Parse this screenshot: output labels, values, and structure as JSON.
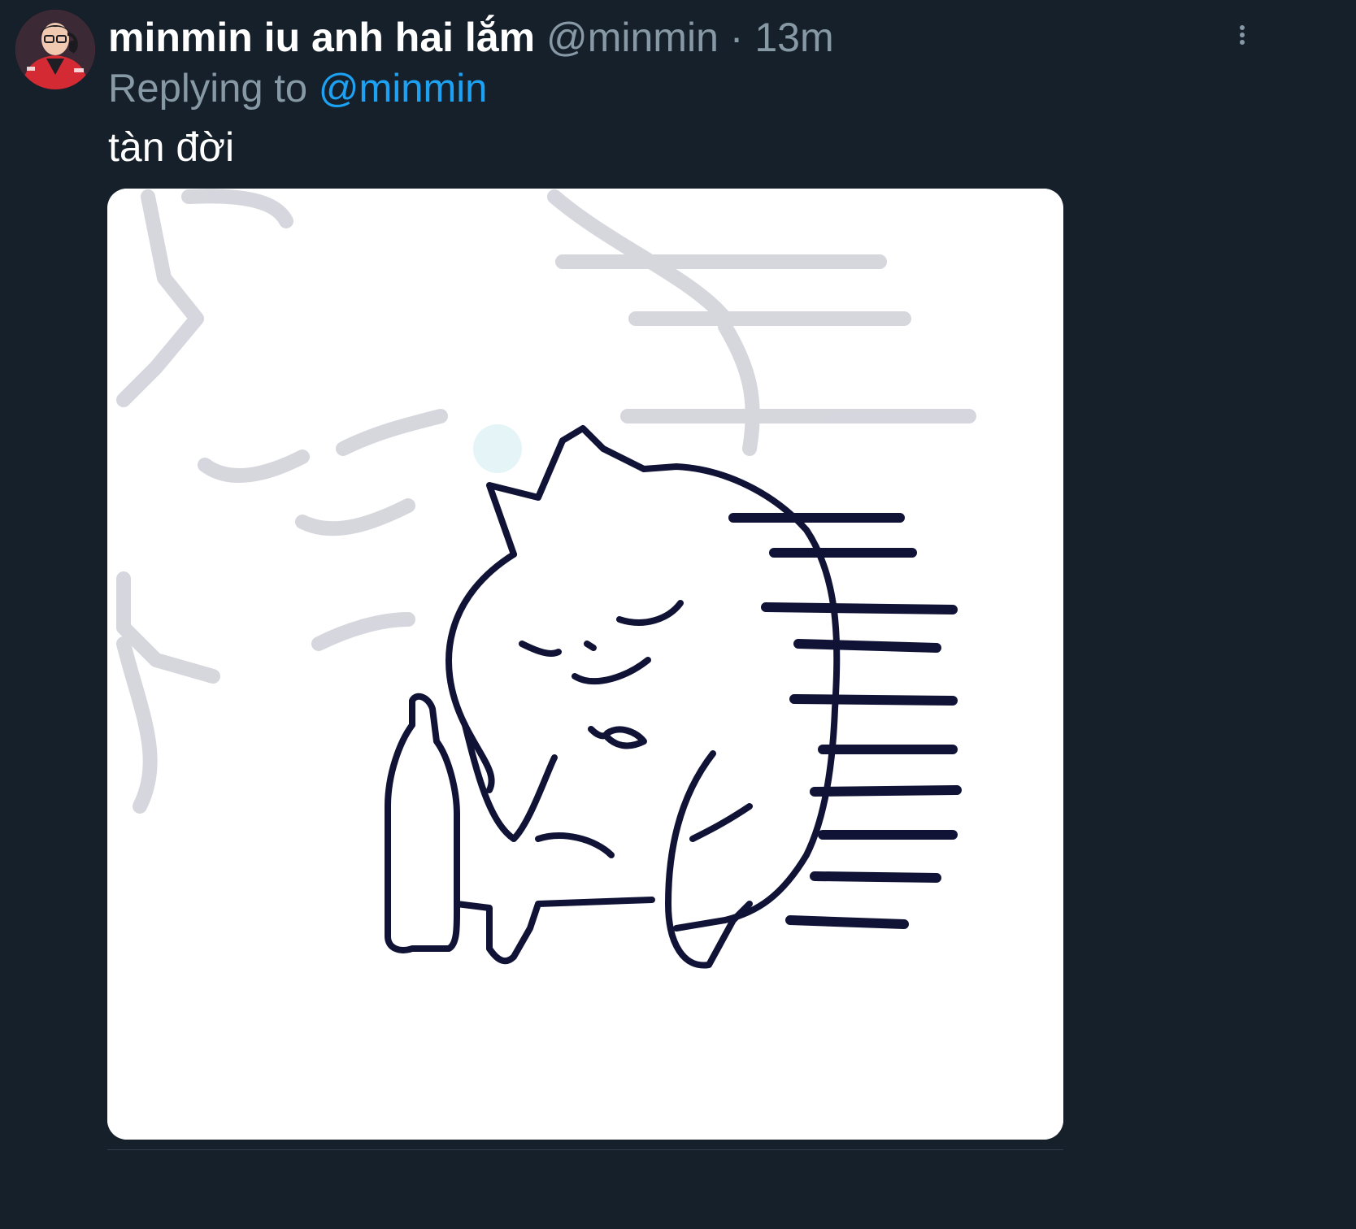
{
  "tweet": {
    "display_name": "minmin iu anh hai lắm",
    "handle": "@minmin",
    "separator": "·",
    "timestamp": "13m",
    "reply_prefix": "Replying to",
    "reply_handle": "@minmin",
    "text": "tàn đời"
  },
  "icons": {
    "more": "more-vertical-icon",
    "avatar": "profile-avatar"
  },
  "colors": {
    "background": "#15202b",
    "name": "#ffffff",
    "secondary_text": "#8899a6",
    "link": "#1da1f2",
    "avatar_jacket": "#c7252e",
    "sketch_stroke": "#101336",
    "faded_stroke": "#cfd0d8"
  }
}
